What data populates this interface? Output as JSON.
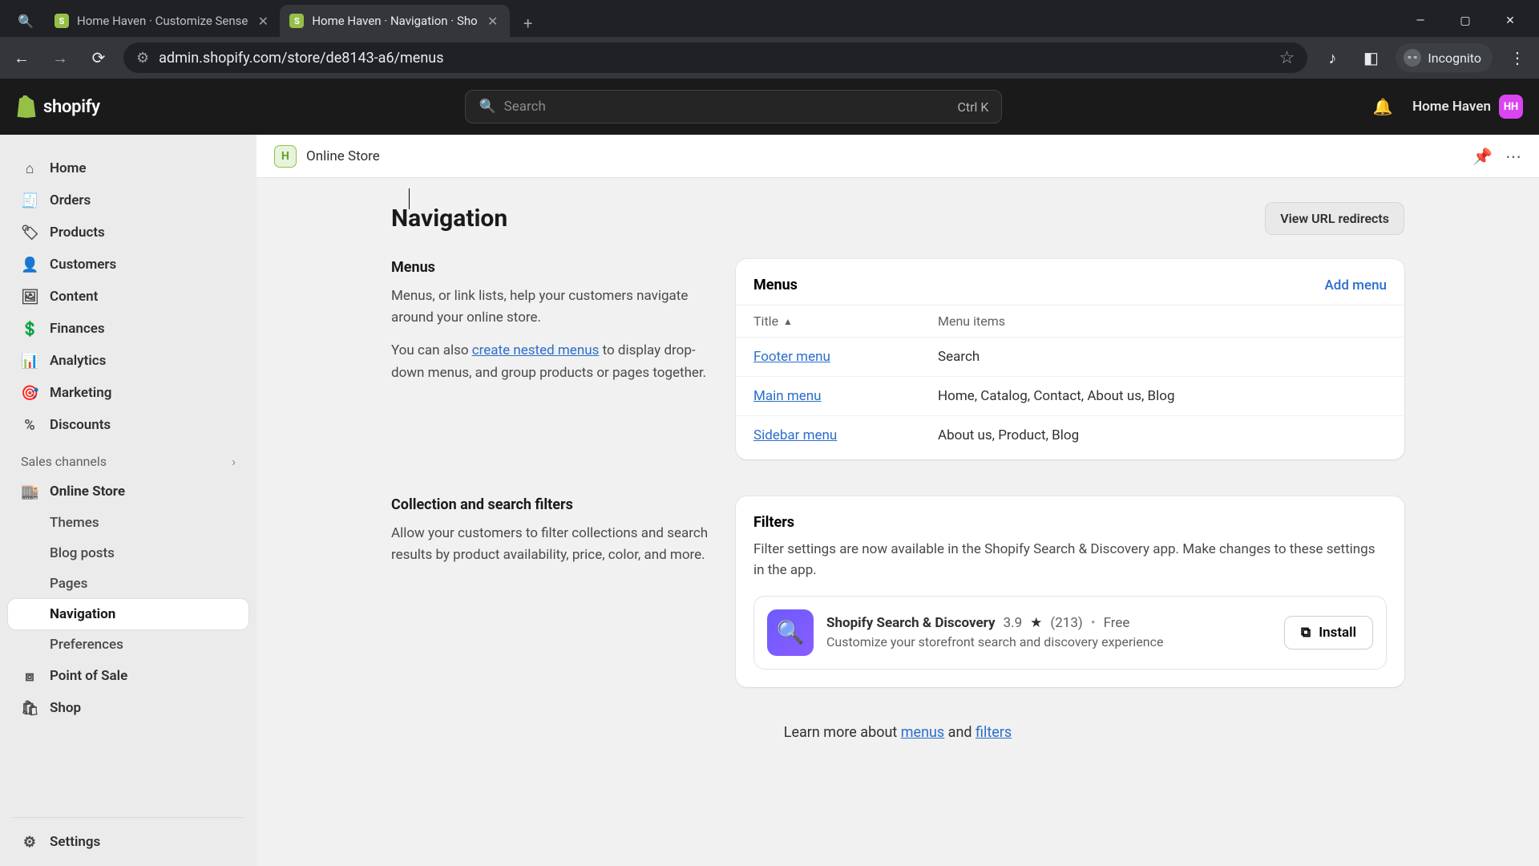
{
  "browser": {
    "tabs": [
      {
        "title": "Home Haven · Customize Sense",
        "active": false
      },
      {
        "title": "Home Haven · Navigation · Sho",
        "active": true
      }
    ],
    "url": "admin.shopify.com/store/de8143-a6/menus",
    "incognito_label": "Incognito"
  },
  "topbar": {
    "brand": "shopify",
    "search_placeholder": "Search",
    "search_shortcut": "Ctrl K",
    "store_name": "Home Haven",
    "store_initials": "HH"
  },
  "sidebar": {
    "primary": [
      {
        "label": "Home",
        "icon": "home-icon"
      },
      {
        "label": "Orders",
        "icon": "orders-icon"
      },
      {
        "label": "Products",
        "icon": "products-icon"
      },
      {
        "label": "Customers",
        "icon": "customers-icon"
      },
      {
        "label": "Content",
        "icon": "content-icon"
      },
      {
        "label": "Finances",
        "icon": "finances-icon"
      },
      {
        "label": "Analytics",
        "icon": "analytics-icon"
      },
      {
        "label": "Marketing",
        "icon": "marketing-icon"
      },
      {
        "label": "Discounts",
        "icon": "discounts-icon"
      }
    ],
    "section_label": "Sales channels",
    "channels": [
      {
        "label": "Online Store",
        "icon": "online-store-icon",
        "sub": [
          {
            "label": "Themes",
            "active": false
          },
          {
            "label": "Blog posts",
            "active": false
          },
          {
            "label": "Pages",
            "active": false
          },
          {
            "label": "Navigation",
            "active": true
          },
          {
            "label": "Preferences",
            "active": false
          }
        ]
      },
      {
        "label": "Point of Sale",
        "icon": "pos-icon"
      },
      {
        "label": "Shop",
        "icon": "shop-icon"
      }
    ],
    "settings_label": "Settings"
  },
  "crumb": {
    "store_name": "Online Store"
  },
  "page": {
    "title": "Navigation",
    "redirects_btn": "View URL redirects",
    "menus_info_heading": "Menus",
    "menus_info_p1": "Menus, or link lists, help your customers navigate around your online store.",
    "menus_info_p2_pre": "You can also ",
    "menus_info_link": "create nested menus",
    "menus_info_p2_post": " to display drop-down menus, and group products or pages together.",
    "menus_card_title": "Menus",
    "add_menu": "Add menu",
    "col_title": "Title",
    "col_items": "Menu items",
    "menu_rows": [
      {
        "title": "Footer menu",
        "items": "Search"
      },
      {
        "title": "Main menu",
        "items": "Home, Catalog, Contact, About us, Blog"
      },
      {
        "title": "Sidebar menu",
        "items": "About us, Product, Blog"
      }
    ],
    "filters_info_heading": "Collection and search filters",
    "filters_info_p": "Allow your customers to filter collections and search results by product availability, price, color, and more.",
    "filters_card_title": "Filters",
    "filters_card_p": "Filter settings are now available in the Shopify Search & Discovery app. Make changes to these settings in the app.",
    "app_name": "Shopify Search & Discovery",
    "app_rating": "3.9",
    "app_reviews": "(213)",
    "app_price": "Free",
    "app_desc": "Customize your storefront search and discovery experience",
    "install_label": "Install",
    "learn_pre": "Learn more about ",
    "learn_menus": "menus",
    "learn_mid": " and ",
    "learn_filters": "filters"
  }
}
